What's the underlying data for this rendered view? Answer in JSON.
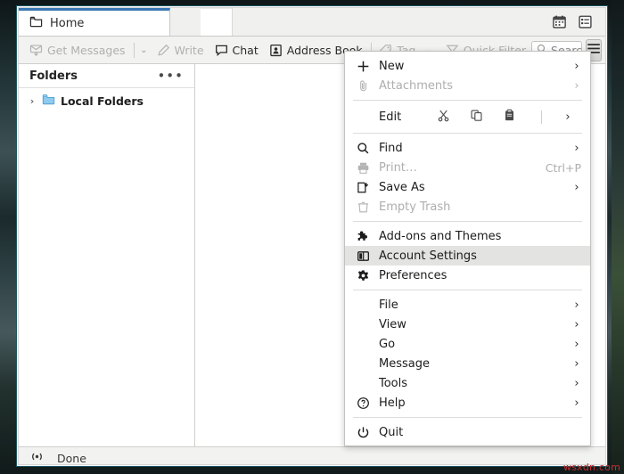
{
  "window": {
    "tab": {
      "label": "Home",
      "icon": "folder-icon"
    },
    "title_icons": [
      {
        "name": "calendar-icon",
        "label": "Calendar"
      },
      {
        "name": "tasks-icon",
        "label": "Tasks"
      }
    ]
  },
  "toolbar": {
    "get_messages": {
      "label": "Get Messages",
      "icon": "download-mail-icon",
      "disabled": true
    },
    "get_messages_dropdown": {
      "glyph": "⌄"
    },
    "write": {
      "label": "Write",
      "icon": "pencil-icon",
      "disabled": true
    },
    "chat": {
      "label": "Chat",
      "icon": "chat-bubble-icon",
      "disabled": false
    },
    "address_book": {
      "label": "Address Book",
      "icon": "address-book-icon",
      "disabled": false
    },
    "tag": {
      "label": "Tag",
      "icon": "tag-icon",
      "disabled": true,
      "dropdown_glyph": "⌄"
    },
    "quick_filter": {
      "label": "Quick Filter",
      "icon": "funnel-icon",
      "disabled": true
    },
    "search": {
      "value": "Search <C",
      "placeholder": "Search <Ctrl+K>",
      "icon": "search-icon"
    },
    "app_menu_button": {
      "name": "hamburger-icon",
      "label": "Application Menu"
    }
  },
  "sidebar": {
    "header": {
      "title": "Folders",
      "more_glyph": "•••"
    },
    "items": [
      {
        "label": "Local Folders",
        "icon": "folder-icon",
        "twisty": "›",
        "expanded": false
      }
    ]
  },
  "statusbar": {
    "icon": "broadcast-icon",
    "text": "Done"
  },
  "app_menu": {
    "groups": [
      {
        "items": [
          {
            "label": "New",
            "icon": "plus-icon",
            "submenu": true,
            "disabled": false,
            "accel": ""
          },
          {
            "label": "Attachments",
            "icon": "paperclip-icon",
            "submenu": true,
            "disabled": true,
            "accel": ""
          }
        ]
      },
      {
        "items": [
          {
            "label": "Edit",
            "icon": "",
            "submenu": true,
            "disabled": false,
            "accel": "",
            "is_edit_row": true,
            "actions": [
              {
                "name": "cut-icon",
                "label": "Cut"
              },
              {
                "name": "copy-icon",
                "label": "Copy"
              },
              {
                "name": "paste-icon",
                "label": "Paste"
              }
            ]
          }
        ]
      },
      {
        "items": [
          {
            "label": "Find",
            "icon": "search-icon",
            "submenu": true,
            "disabled": false,
            "accel": ""
          },
          {
            "label": "Print…",
            "icon": "printer-icon",
            "submenu": false,
            "disabled": true,
            "accel": "Ctrl+P"
          },
          {
            "label": "Save As",
            "icon": "save-as-icon",
            "submenu": true,
            "disabled": false,
            "accel": ""
          },
          {
            "label": "Empty Trash",
            "icon": "trash-icon",
            "submenu": false,
            "disabled": true,
            "accel": ""
          }
        ]
      },
      {
        "items": [
          {
            "label": "Add-ons and Themes",
            "icon": "puzzle-icon",
            "submenu": false,
            "disabled": false,
            "accel": ""
          },
          {
            "label": "Account Settings",
            "icon": "account-panel-icon",
            "submenu": false,
            "disabled": false,
            "accel": "",
            "highlighted": true
          },
          {
            "label": "Preferences",
            "icon": "gear-icon",
            "submenu": false,
            "disabled": false,
            "accel": ""
          }
        ]
      },
      {
        "items": [
          {
            "label": "File",
            "icon": "",
            "submenu": true,
            "disabled": false,
            "accel": "",
            "indent": true
          },
          {
            "label": "View",
            "icon": "",
            "submenu": true,
            "disabled": false,
            "accel": "",
            "indent": true
          },
          {
            "label": "Go",
            "icon": "",
            "submenu": true,
            "disabled": false,
            "accel": "",
            "indent": true
          },
          {
            "label": "Message",
            "icon": "",
            "submenu": true,
            "disabled": false,
            "accel": "",
            "indent": true
          },
          {
            "label": "Tools",
            "icon": "",
            "submenu": true,
            "disabled": false,
            "accel": "",
            "indent": true
          },
          {
            "label": "Help",
            "icon": "help-circle-icon",
            "submenu": true,
            "disabled": false,
            "accel": ""
          }
        ]
      },
      {
        "items": [
          {
            "label": "Quit",
            "icon": "power-icon",
            "submenu": false,
            "disabled": false,
            "accel": ""
          }
        ]
      }
    ]
  },
  "watermark": {
    "text": "wsxdn.com"
  },
  "colors": {
    "active_tab_accent": "#3a78b4",
    "folder_icon": "#8fcaf0",
    "window_border": "#1b5560",
    "menu_highlight": "#e3e3e1"
  }
}
